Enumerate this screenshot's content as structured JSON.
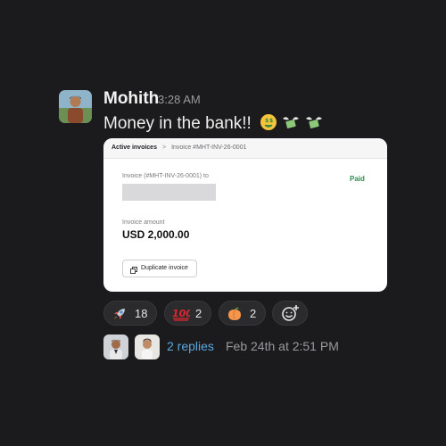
{
  "message": {
    "author": "Mohith",
    "time": "3:28 AM",
    "text": "Money in the bank!!",
    "inline_emoji": [
      "money-mouth-face",
      "money-with-wings",
      "money-with-wings"
    ]
  },
  "invoice_card": {
    "breadcrumb_parent": "Active invoices",
    "breadcrumb_separator": ">",
    "breadcrumb_current": "Invoice #MHT-INV-26-0001",
    "invoice_label": "Invoice (#MHT-INV-26-0001) to",
    "status": "Paid",
    "amount_label": "Invoice amount",
    "amount": "USD 2,000.00",
    "duplicate_button": "Duplicate invoice"
  },
  "reactions": [
    {
      "emoji": "rocket",
      "count": "18"
    },
    {
      "emoji": "hundred-points",
      "count": "2"
    },
    {
      "emoji": "peach",
      "count": "2"
    }
  ],
  "thread": {
    "replies_label": "2 replies",
    "last_reply": "Feb 24th at 2:51 PM"
  },
  "colors": {
    "background": "#1b1b1d",
    "link": "#5aa7de",
    "paid_green": "#2f8e52"
  }
}
